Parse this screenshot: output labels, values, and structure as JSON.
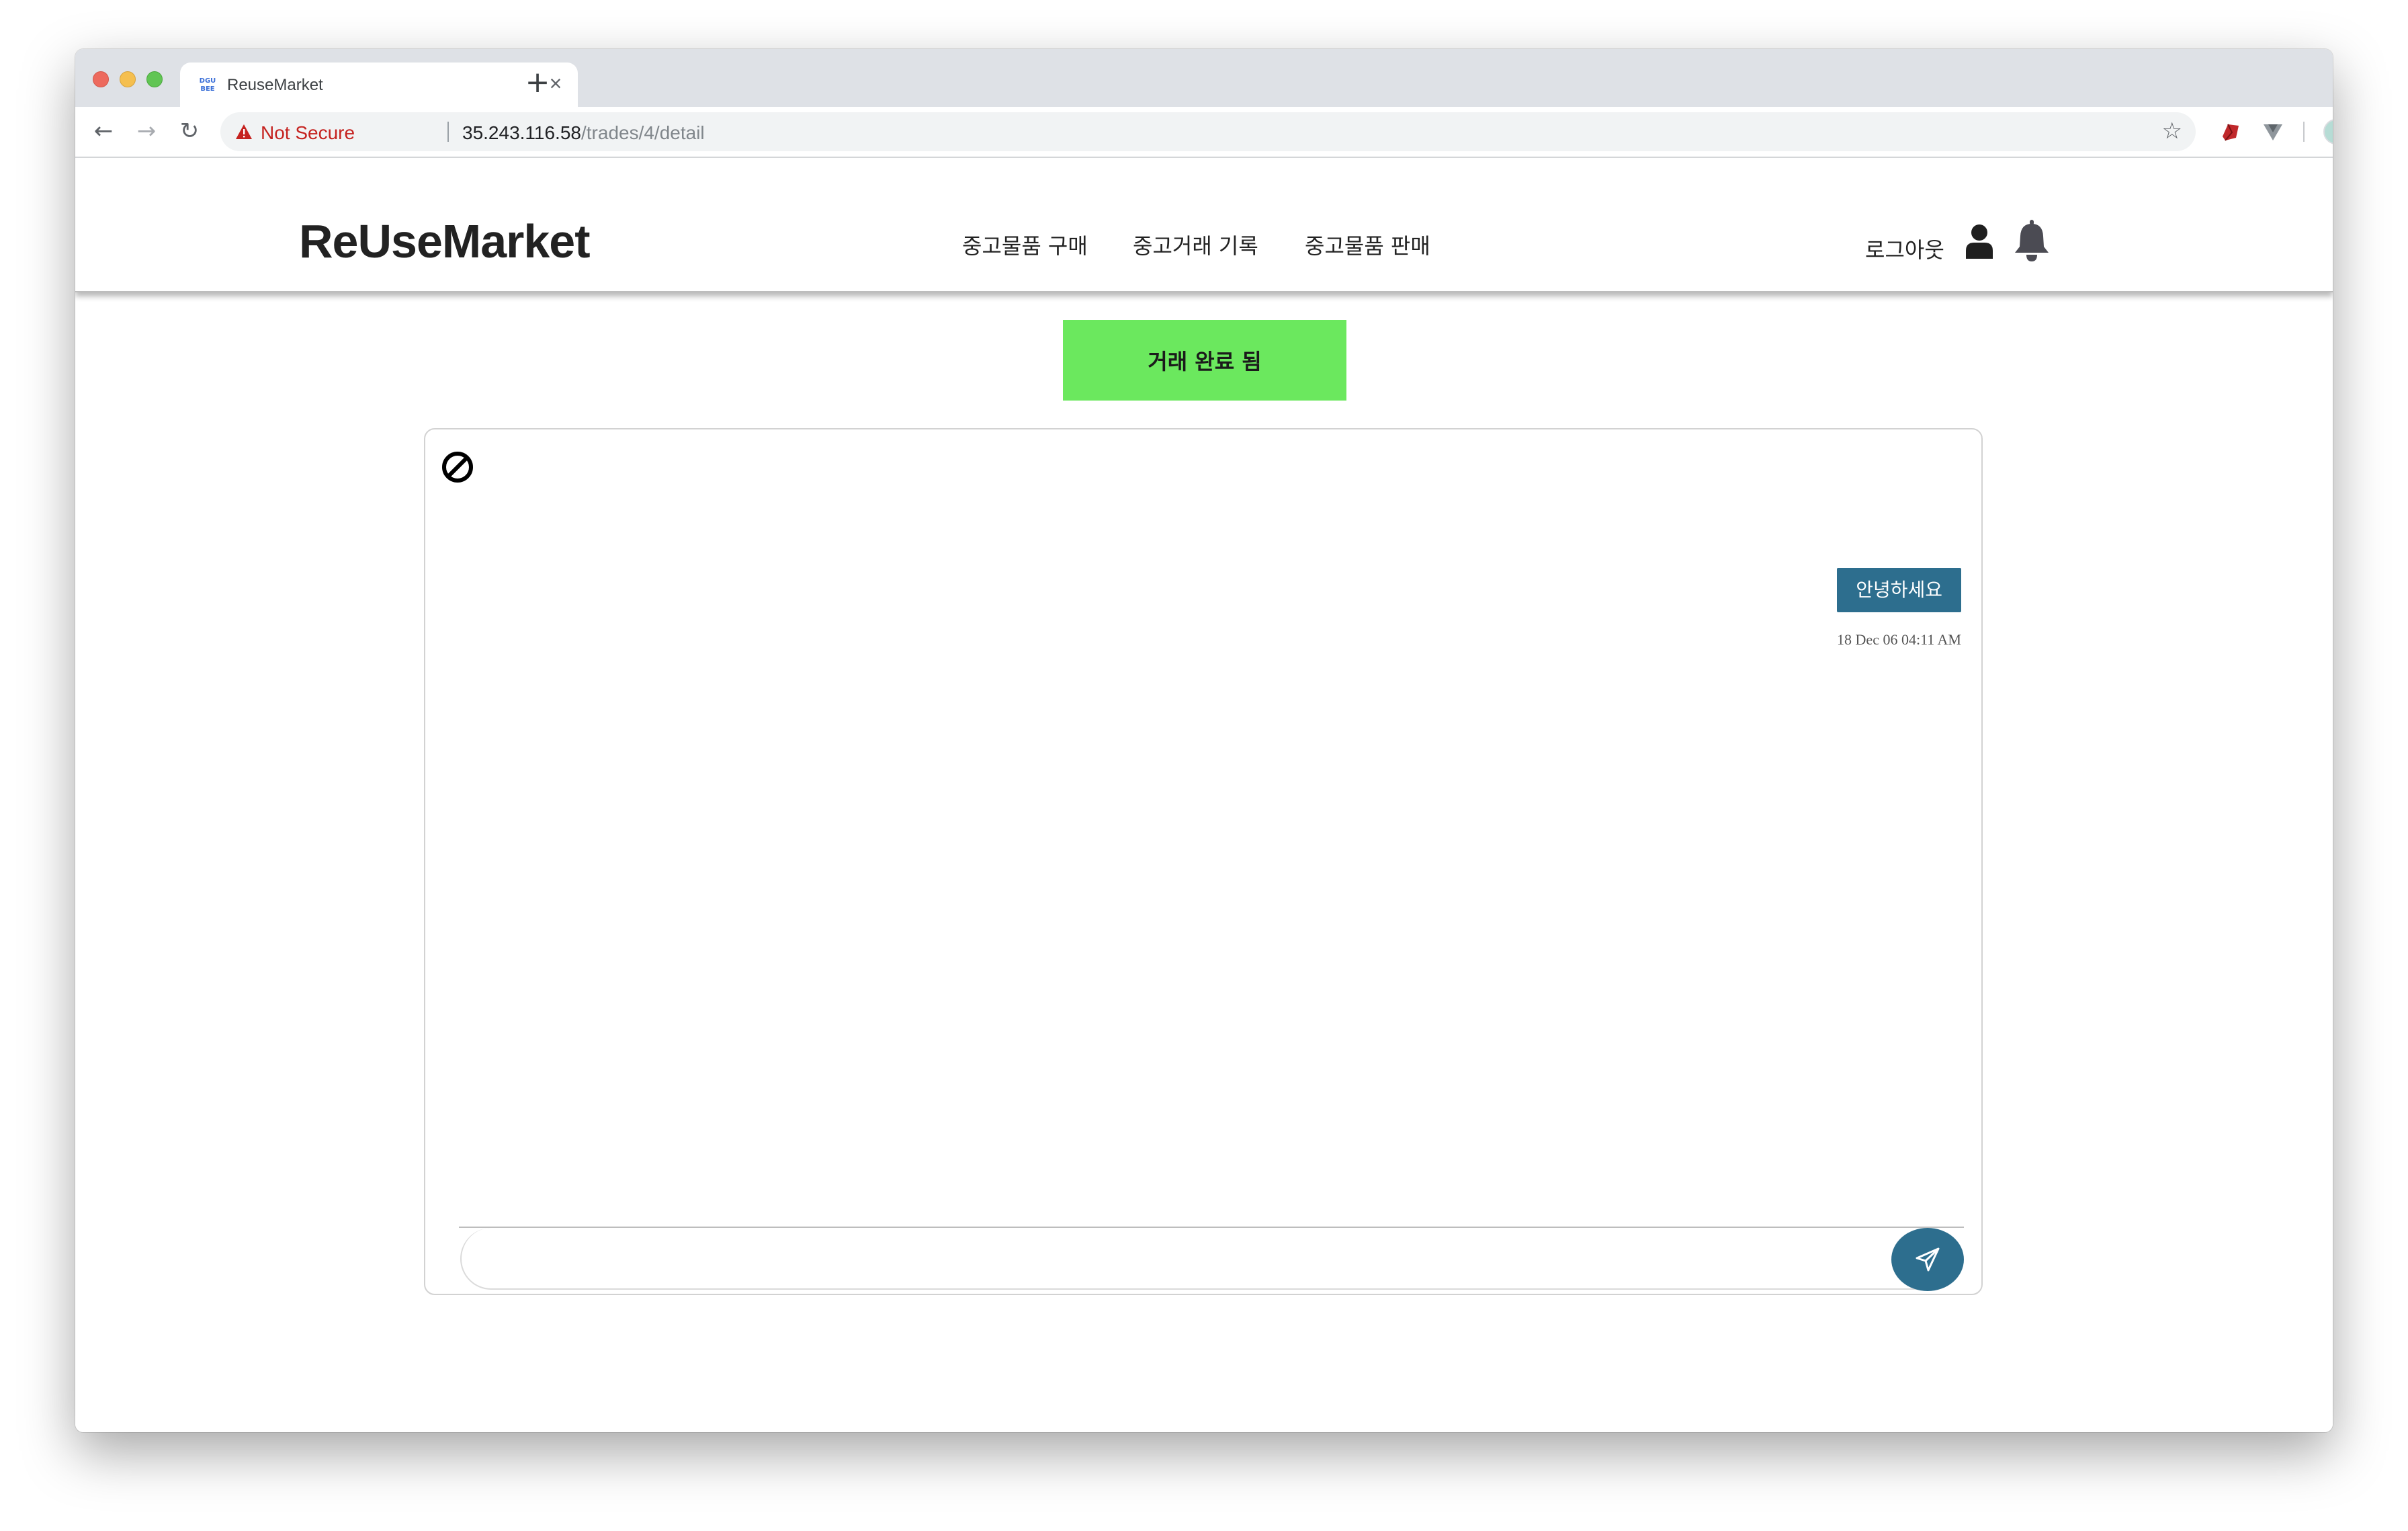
{
  "browser": {
    "tab_title": "ReuseMarket",
    "favicon_text": "DGU\nBEE",
    "security_label": "Not Secure",
    "url_host": "35.243.116.58",
    "url_path": "/trades/4/detail"
  },
  "site": {
    "logo": "ReUseMarket",
    "nav": [
      "중고물품 구매",
      "중고거래 기록",
      "중고물품 판매"
    ],
    "logout": "로그아웃"
  },
  "trade": {
    "status_button": "거래 완료 됨"
  },
  "chat": {
    "messages": [
      {
        "text": "안녕하세요",
        "time": "18 Dec 06 04:11 AM",
        "side": "right"
      }
    ],
    "input_value": ""
  },
  "colors": {
    "status_green": "#6be85e",
    "bubble_blue": "#2d6e8e"
  }
}
